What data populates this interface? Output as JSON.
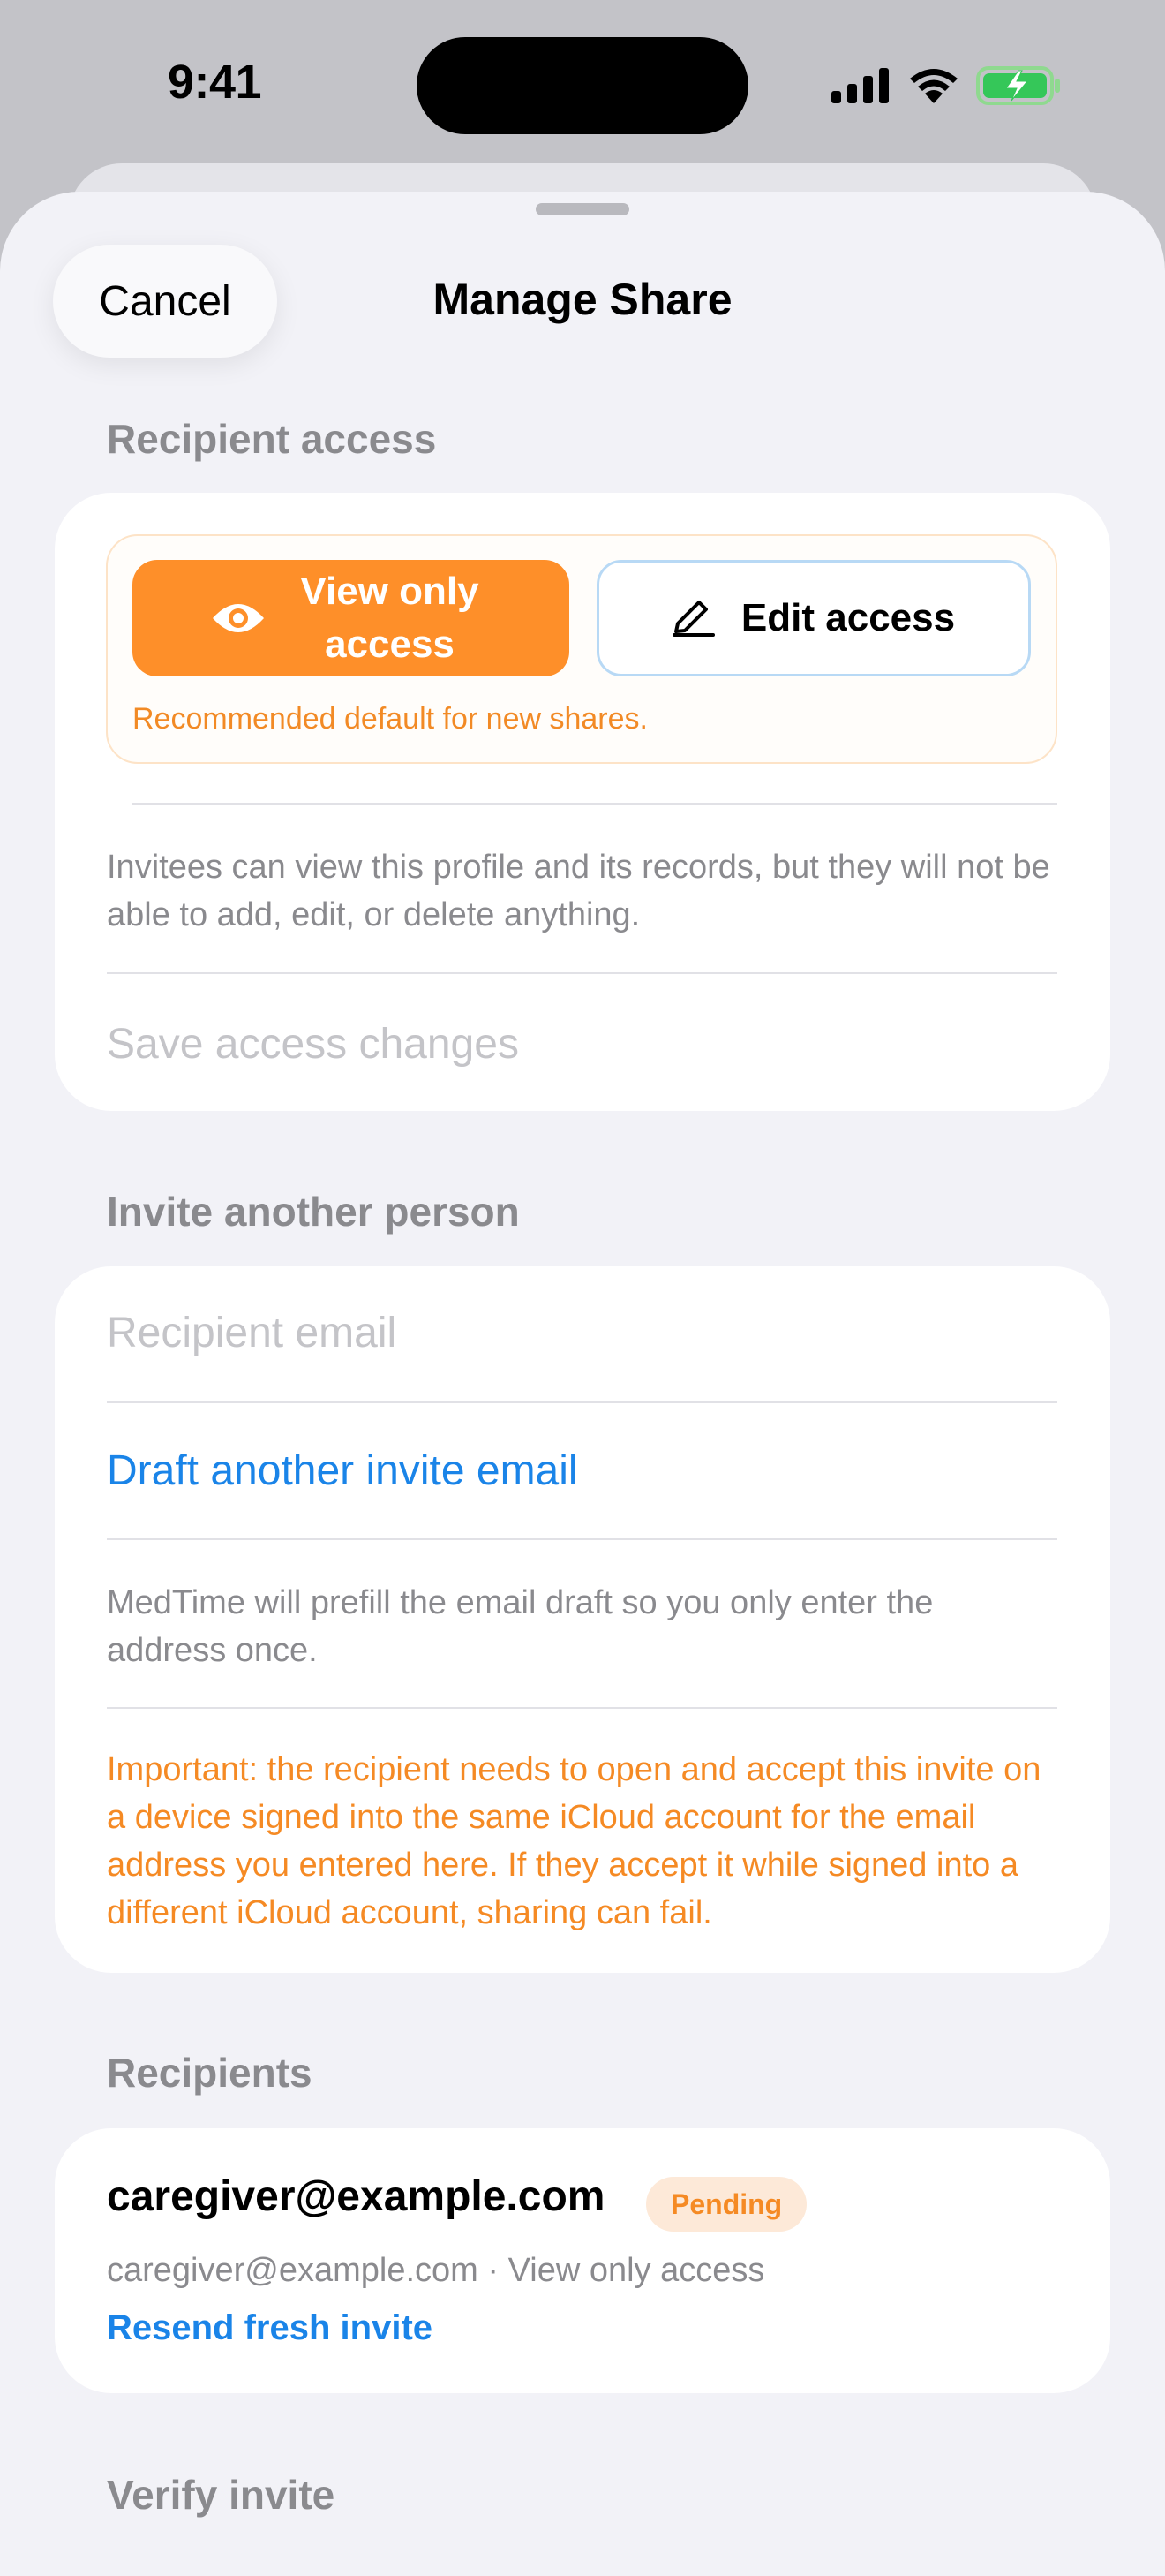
{
  "status_bar": {
    "time": "9:41"
  },
  "nav": {
    "cancel_label": "Cancel",
    "title": "Manage Share"
  },
  "recipient_access": {
    "section_label": "Recipient access",
    "options": [
      {
        "label": "View only access",
        "selected": true,
        "icon": "eye-icon"
      },
      {
        "label": "Edit access",
        "selected": false,
        "icon": "pencil-icon"
      }
    ],
    "hint": "Recommended default for new shares.",
    "description": "Invitees can view this profile and its records, but they will not be able to add, edit, or delete anything.",
    "save_label": "Save access changes"
  },
  "invite": {
    "section_label": "Invite another person",
    "email_placeholder": "Recipient email",
    "email_value": "",
    "draft_link": "Draft another invite email",
    "prefill_note": "MedTime will prefill the email draft so you only enter the address once.",
    "warning": "Important: the recipient needs to open and accept this invite on a device signed into the same iCloud account for the email address you entered here. If they accept it while signed into a different iCloud account, sharing can fail."
  },
  "recipients": {
    "section_label": "Recipients",
    "items": [
      {
        "email": "caregiver@example.com",
        "status": "Pending",
        "detail": "caregiver@example.com · View only access",
        "action": "Resend fresh invite"
      }
    ]
  },
  "verify": {
    "section_label": "Verify invite"
  },
  "colors": {
    "accent": "#fe8f29",
    "link": "#1a84e8",
    "warning": "#f58a24"
  }
}
